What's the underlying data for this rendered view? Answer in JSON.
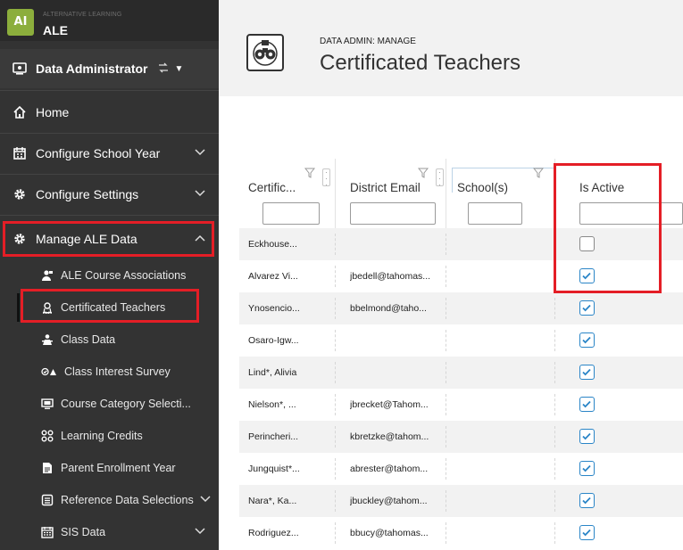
{
  "app": {
    "logo_text": "AI",
    "subtitle": "ALTERNATIVE LEARNING",
    "name": "ALE"
  },
  "role": {
    "label": "Data Administrator"
  },
  "nav": {
    "home": "Home",
    "configure_school_year": "Configure School Year",
    "configure_settings": "Configure Settings",
    "manage_ale_data": "Manage ALE Data",
    "sub_items": [
      "ALE Course Associations",
      "Certificated Teachers",
      "Class Data",
      "Class Interest Survey",
      "Course Category Selecti...",
      "Learning Credits",
      "Parent Enrollment Year",
      "Reference Data Selections",
      "SIS Data"
    ]
  },
  "header": {
    "eyebrow": "DATA ADMIN: MANAGE",
    "title": "Certificated Teachers"
  },
  "grid": {
    "columns": [
      "Certific...",
      "District Email",
      "School(s)",
      "Is Active"
    ],
    "rows": [
      {
        "name": "Eckhouse...",
        "email": "",
        "school": "",
        "active": false
      },
      {
        "name": "Alvarez Vi...",
        "email": "jbedell@tahomas...",
        "school": "",
        "active": true
      },
      {
        "name": "Ynosencio...",
        "email": "bbelmond@taho...",
        "school": "",
        "active": true
      },
      {
        "name": "Osaro-Igw...",
        "email": "",
        "school": "",
        "active": true
      },
      {
        "name": "Lind*, Alivia",
        "email": "",
        "school": "",
        "active": true
      },
      {
        "name": "Nielson*, ...",
        "email": "jbrecket@Tahom...",
        "school": "",
        "active": true
      },
      {
        "name": "Perincheri...",
        "email": "kbretzke@tahom...",
        "school": "",
        "active": true
      },
      {
        "name": "Jungquist*...",
        "email": "abrester@tahom...",
        "school": "",
        "active": true
      },
      {
        "name": "Nara*, Ka...",
        "email": "jbuckley@tahom...",
        "school": "",
        "active": true
      },
      {
        "name": "Rodriguez...",
        "email": "bbucy@tahomas...",
        "school": "",
        "active": true
      }
    ]
  },
  "colors": {
    "sidebar": "#333333",
    "highlight": "#e41e26",
    "checkbox": "#2a85c7",
    "brand": "#8cae3c"
  }
}
